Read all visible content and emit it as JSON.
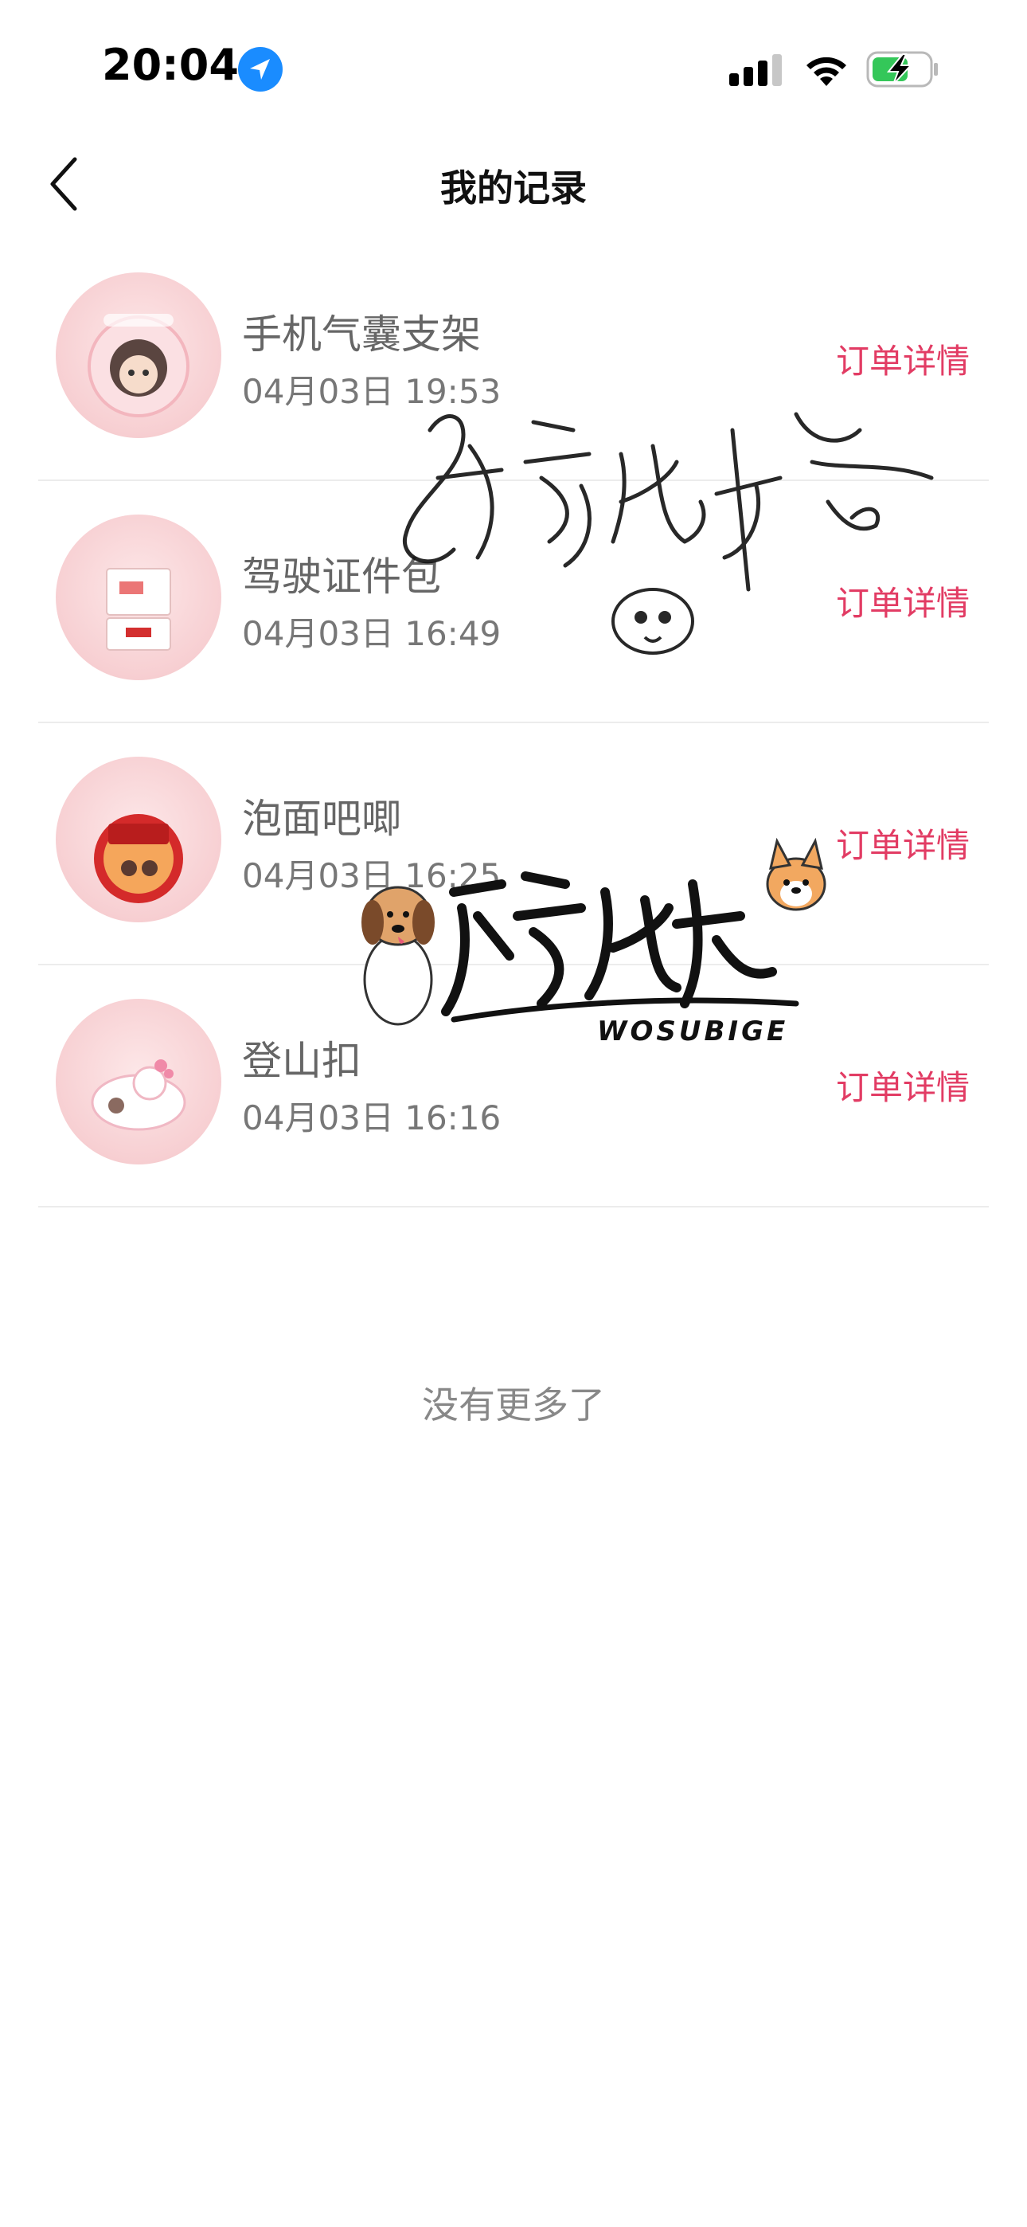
{
  "status_bar": {
    "time": "20:04",
    "icons": [
      "location-arrow-icon",
      "cellular-signal-icon",
      "wifi-icon",
      "battery-charging-icon"
    ]
  },
  "nav": {
    "title": "我的记录",
    "back_icon": "chevron-left-icon"
  },
  "records": [
    {
      "name": "手机气囊支架",
      "time": "04月03日 19:53",
      "action": "订单详情",
      "thumb_icon": "girl-badge-thumbnail"
    },
    {
      "name": "驾驶证件包",
      "time": "04月03日 16:49",
      "action": "订单详情",
      "thumb_icon": "card-holder-thumbnail"
    },
    {
      "name": "泡面吧唧",
      "time": "04月03日 16:25",
      "action": "订单详情",
      "thumb_icon": "cup-noodles-thumbnail"
    },
    {
      "name": "登山扣",
      "time": "04月03日 16:16",
      "action": "订单详情",
      "thumb_icon": "carabiner-charm-thumbnail"
    }
  ],
  "footer": {
    "no_more": "没有更多了"
  },
  "watermarks": {
    "signature_text": "窝素比格",
    "logo_text": "窝素比格",
    "logo_subtext": "WOSUBIGE"
  },
  "colors": {
    "accent": "#e23c64",
    "text_secondary": "#666666",
    "divider": "#ececec"
  }
}
